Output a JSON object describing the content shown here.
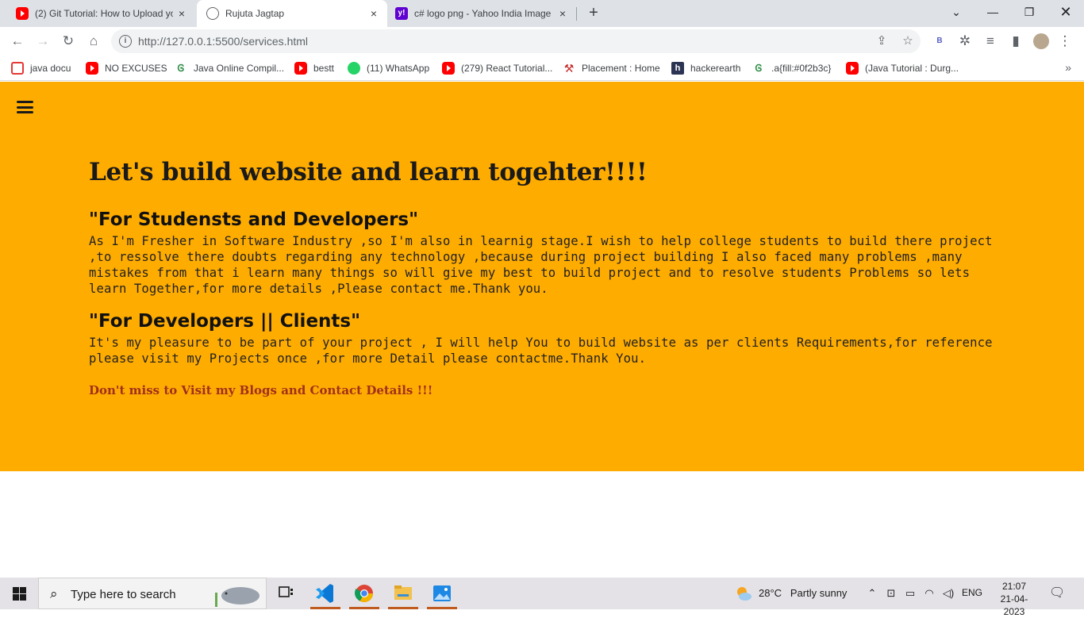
{
  "browser": {
    "tabs": [
      {
        "title": "(2) Git Tutorial: How to Upload yo",
        "icon": "youtube-icon"
      },
      {
        "title": "Rujuta Jagtap",
        "icon": "globe-icon",
        "active": true
      },
      {
        "title": "c# logo png - Yahoo India Image",
        "icon": "yahoo-icon"
      }
    ],
    "url": "http://127.0.0.1:5500/services.html",
    "profile_letter": "B",
    "bookmarks": [
      {
        "label": "java docu",
        "icon": "doc-icon"
      },
      {
        "label": "NO EXCUSES",
        "icon": "youtube-icon"
      },
      {
        "label": "Java Online Compil...",
        "icon": "gfg-icon"
      },
      {
        "label": "bestt",
        "icon": "youtube-icon"
      },
      {
        "label": "(11) WhatsApp",
        "icon": "whatsapp-icon"
      },
      {
        "label": "(279) React Tutorial...",
        "icon": "youtube-icon"
      },
      {
        "label": "Placement : Home",
        "icon": "placement-icon"
      },
      {
        "label": "hackerearth",
        "icon": "hackerearth-icon"
      },
      {
        "label": ".a{fill:#0f2b3c}",
        "icon": "gfg-icon"
      },
      {
        "label": "(Java Tutorial : Durg...",
        "icon": "youtube-icon"
      }
    ]
  },
  "page": {
    "title": "Let's build website and learn togehter!!!!",
    "sections": [
      {
        "heading": "\"For Studensts and Developers\"",
        "body": "As I'm Fresher in Software Industry ,so I'm also in learnig stage.I wish to help college students to build there project ,to ressolve there doubts regarding any technology ,because during project building I also faced many problems ,many mistakes from that i learn many things so will give my best to build project and to resolve students Problems so lets learn Together,for more details ,Please contact me.Thank you."
      },
      {
        "heading": "\"For Developers || Clients\"",
        "body": "It's my pleasure to be part of your project , I will help You to build website as per clients Requirements,for reference please visit my Projects once ,for more Detail please contactme.Thank You."
      }
    ],
    "cta": "Don't miss to Visit my Blogs and Contact Details !!!"
  },
  "taskbar": {
    "search_placeholder": "Type here to search",
    "weather_temp": "28°C",
    "weather_desc": "Partly sunny",
    "language": "ENG",
    "time": "21:07",
    "date": "21-04-2023"
  },
  "colors": {
    "hero_bg": "#ffac00",
    "cta_text": "#a0301a",
    "tabstrip_bg": "#dee1e6"
  }
}
